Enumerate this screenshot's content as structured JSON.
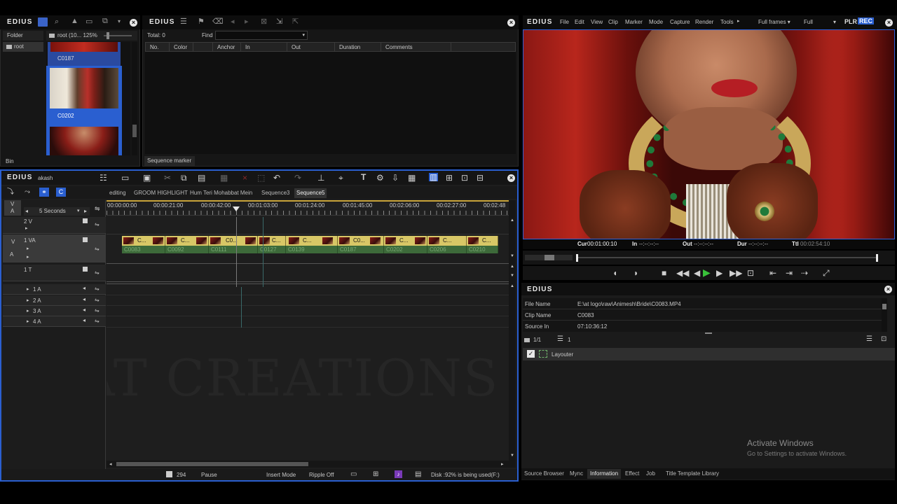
{
  "brand": "EDIUS",
  "bin": {
    "folder_label": "Folder",
    "path": "root (10... 125%",
    "root_item": "root",
    "footer": "Bin",
    "clips": [
      {
        "name": "C0187"
      },
      {
        "name": "C0202"
      }
    ]
  },
  "marker": {
    "total": "Total: 0",
    "find": "Find",
    "columns": [
      "No.",
      "Color",
      "Anchor",
      "In",
      "Out",
      "Duration",
      "Comments"
    ],
    "footer": "Sequence marker"
  },
  "player": {
    "menus": [
      "File",
      "Edit",
      "View",
      "Clip",
      "Marker",
      "Mode",
      "Capture",
      "Render",
      "Tools"
    ],
    "frames": "Full frames",
    "full": "Full",
    "plr": "PLR",
    "rec": "REC",
    "cur_label": "Cur",
    "cur": "00:01:00:10",
    "in_label": "In",
    "in": "--:--:--:--",
    "out_label": "Out",
    "out": "--:--:--:--",
    "dur_label": "Dur",
    "dur": "--:--:--:--",
    "ttl_label": "Ttl",
    "ttl": "00:02:54:10"
  },
  "timeline": {
    "user": "akash",
    "scale": "5 Seconds",
    "tabs": [
      "editing",
      "GROOM HIGHLIGHT",
      "Hum Teri Mohabbat Mein",
      "Sequence3",
      "Sequence5"
    ],
    "ruler": [
      "00:00:00:00",
      "00:00:21:00",
      "00:00:42:00",
      "00:01:03:00",
      "00:01:24:00",
      "00:01:45:00",
      "00:02:06:00",
      "00:02:27:00",
      "00:02:48"
    ],
    "tracks": {
      "v": "V",
      "a": "A",
      "two_v": "2 V",
      "one_va": "1 VA",
      "one_t": "1 T",
      "a1": "1 A",
      "a2": "2 A",
      "a3": "3 A",
      "a4": "4 A"
    },
    "clips": [
      "C...",
      "C...",
      "C0...",
      "C...",
      "C...",
      "C...",
      "C0...",
      "C...",
      "C...",
      "C...",
      "C...",
      "C..."
    ],
    "clip_names": [
      "C0083",
      "C0092",
      "C0111",
      "C0127",
      "C0139",
      "C0187",
      "C0202",
      "C0206",
      "C0210"
    ],
    "watermark": "AT CREATIONS"
  },
  "status": {
    "frame": "294",
    "state": "Pause",
    "mode": "Insert Mode",
    "ripple": "Ripple Off",
    "disk": "Disk :92% is being used(F:)"
  },
  "info": {
    "title": "EDIUS",
    "rows": [
      {
        "k": "File Name",
        "v": "E:\\at logo\\raw\\Animesh\\Bride\\C0083.MP4"
      },
      {
        "k": "Clip Name",
        "v": "C0083"
      },
      {
        "k": "Source In",
        "v": "07:10:36:12"
      }
    ],
    "counter": "1/1",
    "count2": "1",
    "layouter": "Layouter",
    "tabs": [
      "Source Browser",
      "Mync",
      "Information",
      "Effect",
      "Job",
      "Title Template Library"
    ]
  },
  "windows": {
    "title": "Activate Windows",
    "sub": "Go to Settings to activate Windows."
  },
  "colors": {
    "accent": "#2a5fd0",
    "clip": "#d8c766",
    "audio": "#3d6a3a",
    "timecode": "#f5f5f5"
  }
}
